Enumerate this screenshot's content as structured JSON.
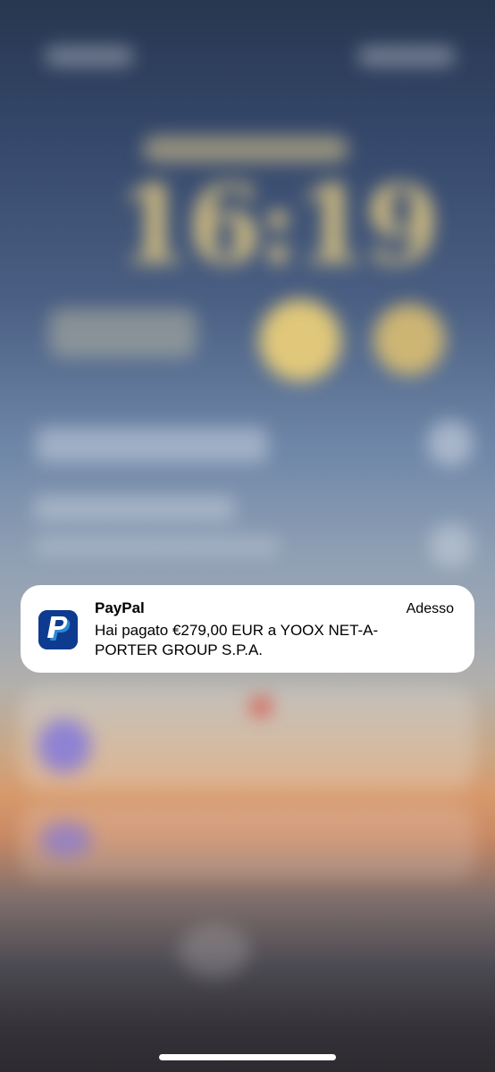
{
  "notification": {
    "app_name": "PayPal",
    "time": "Adesso",
    "message": "Hai pagato €279,00 EUR a YOOX NET-A-PORTER GROUP S.P.A.",
    "icon": "paypal-logo-icon"
  },
  "lock_screen": {
    "clock": "16:19"
  },
  "colors": {
    "paypal_dark_blue": "#0e3b8f",
    "paypal_light_blue": "#2a8ad6",
    "card_background": "#ffffff"
  }
}
